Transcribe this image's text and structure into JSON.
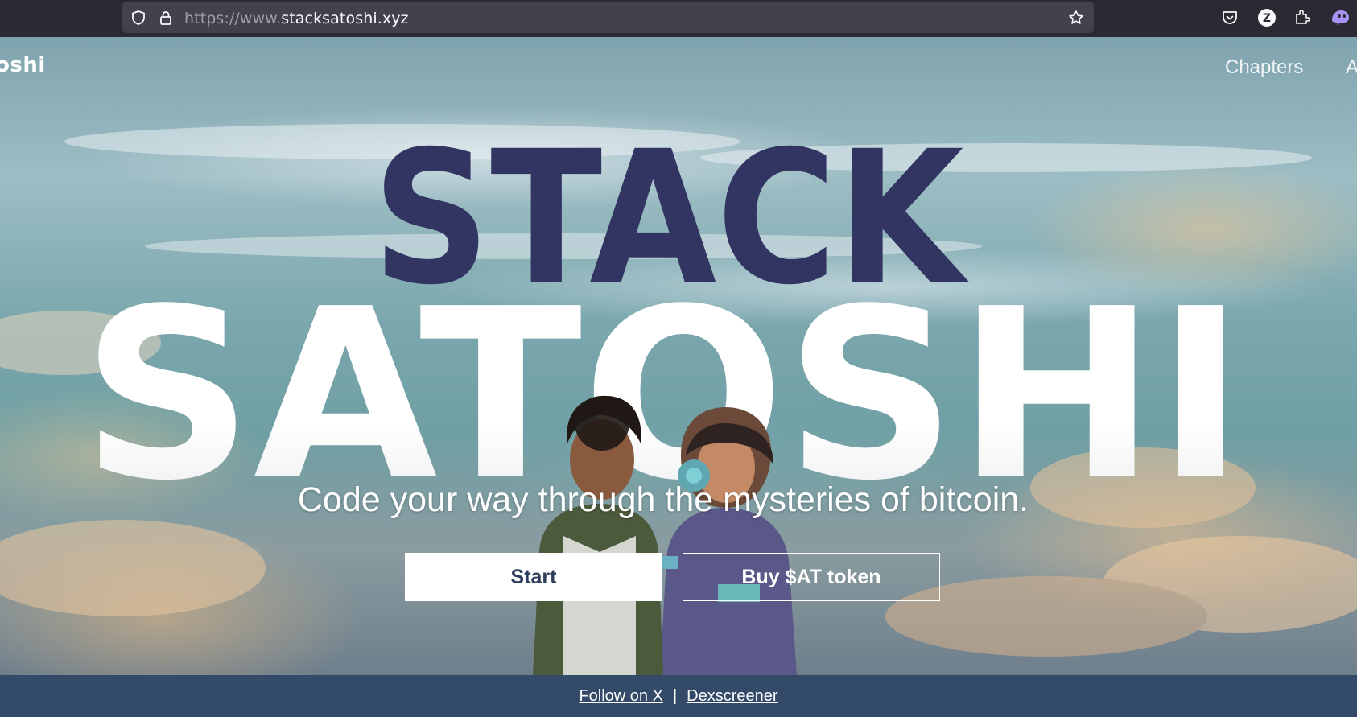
{
  "browser": {
    "url_prefix": "https://www.",
    "url_domain": "stacksatoshi.xyz",
    "icons": [
      "shield-icon",
      "lock-icon",
      "star-icon",
      "pocket-icon",
      "profile-icon",
      "extensions-icon",
      "extension-app-icon"
    ],
    "profile_letter": "Z"
  },
  "nav": {
    "brand": "oshi",
    "chapters": "Chapters",
    "more": "A"
  },
  "hero": {
    "title_top": "STACK",
    "title_bottom": "SATOSHI",
    "tagline": "Code your way through the mysteries of bitcoin.",
    "start_label": "Start",
    "buy_label": "Buy $AT token",
    "colors": {
      "title_top": "#323562",
      "title_bottom": "#ffffff",
      "button_text": "#2c3e5c"
    }
  },
  "footer": {
    "follow_label": "Follow on X",
    "separator": "|",
    "dex_label": "Dexscreener",
    "background": "#334a68"
  }
}
